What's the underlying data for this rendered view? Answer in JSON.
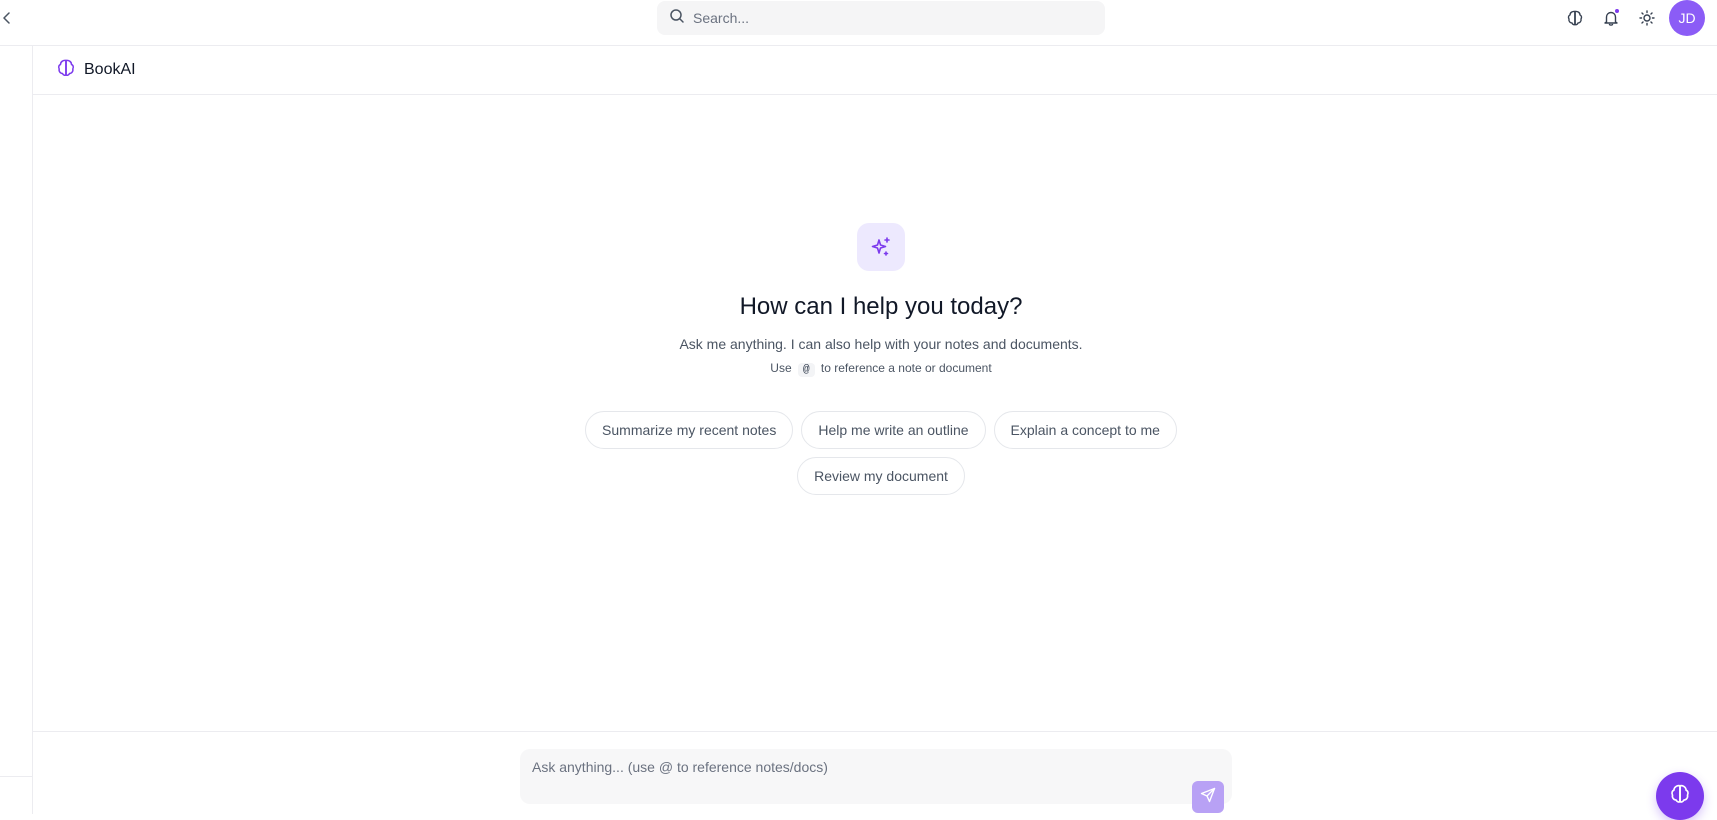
{
  "topbar": {
    "collapse_icon": "chevron-left-icon",
    "search": {
      "placeholder": "Search...",
      "value": ""
    },
    "icons": [
      "brain-icon",
      "bell-icon",
      "sun-icon"
    ],
    "avatar": {
      "initials": "JD",
      "color": "#8b5cf6"
    }
  },
  "header": {
    "brand_icon": "brain-icon",
    "title": "BookAI"
  },
  "hero": {
    "icon": "sparkles-icon",
    "title": "How can I help you today?",
    "subtitle": "Ask me anything. I can also help with your notes and documents.",
    "hint_prefix": "Use",
    "hint_key": "@",
    "hint_suffix": "to reference a note or document"
  },
  "suggestions": {
    "row1": [
      "Summarize my recent notes",
      "Help me write an outline",
      "Explain a concept to me"
    ],
    "row2": [
      "Review my document"
    ]
  },
  "composer": {
    "placeholder": "Ask anything... (use @ to reference notes/docs)",
    "value": "",
    "send_icon": "send-icon"
  },
  "fab": {
    "icon": "brain-icon"
  },
  "colors": {
    "accent": "#7c3aed",
    "accent_light": "#ede9fe",
    "send_disabled": "#b8a1f5"
  }
}
